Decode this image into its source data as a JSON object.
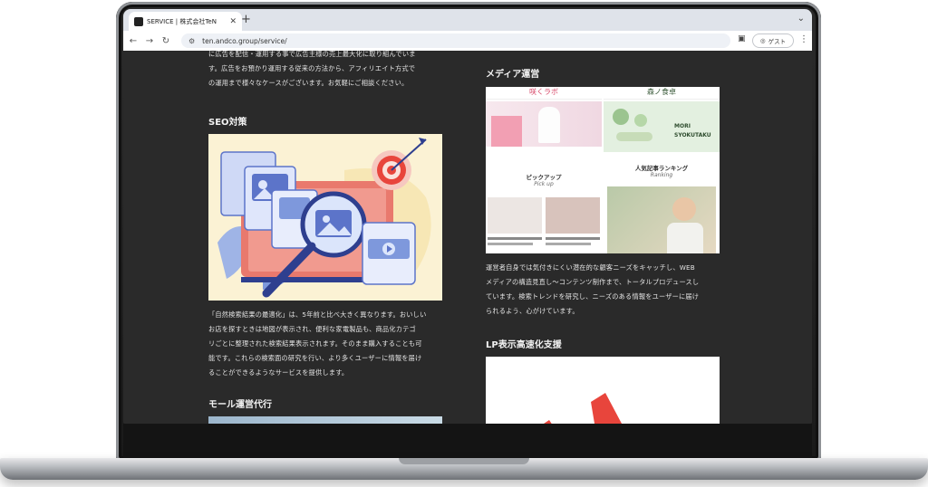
{
  "browser": {
    "tab_title": "SERVICE | 株式会社TeN",
    "new_tab": "+",
    "url": "ten.andco.group/service/",
    "guest_label": "ゲスト"
  },
  "left": {
    "intro_lines": [
      "に広告を配信・運用する事で広告主様の売上最大化に取り組んでいま",
      "す。広告をお預かり運用する従来の方法から、アフィリエイト方式で",
      "の運用まで様々なケースがございます。お気軽にご相談ください。"
    ],
    "seo_heading": "SEO対策",
    "seo_lines": [
      "「自然検索結果の最適化」は、5年前と比べ大きく異なります。おいしい",
      "お店を探すときは地図が表示され、便利な家電製品も、商品化カテゴ",
      "リごとに整理された検索結果表示されます。そのまま購入することも可",
      "能です。これらの検索面の研究を行い、より多くユーザーに情報を届け",
      "ることができるようなサービスを提供します。"
    ],
    "mall_heading": "モール運営代行"
  },
  "right": {
    "media_heading": "メディア運営",
    "media_sites": {
      "site1_logo": "咲くラボ",
      "site2_logo": "森ノ食卓",
      "site2_tag1": "MORI",
      "site2_tag2": "SYOKUTAKU",
      "pickup_title": "ピックアップ",
      "pickup_sub": "Pick up",
      "ranking_title": "人気記事ランキング",
      "ranking_sub": "Ranking"
    },
    "media_lines": [
      "運営者自身では気付きにくい潜在的な顧客ニーズをキャッチし、WEB",
      "メディアの構造見直し～コンテンツ制作まで、トータルプロデュースし",
      "ています。検索トレンドを研究し、ニーズのある情報をユーザーに届け",
      "られるよう、心がけています。"
    ],
    "lp_heading": "LP表示高速化支援"
  },
  "colors": {
    "page_bg": "#2a2a2a",
    "text": "#e4e4e4",
    "seo_bg": "#fbf2d4",
    "accent_red": "#e8453c"
  }
}
